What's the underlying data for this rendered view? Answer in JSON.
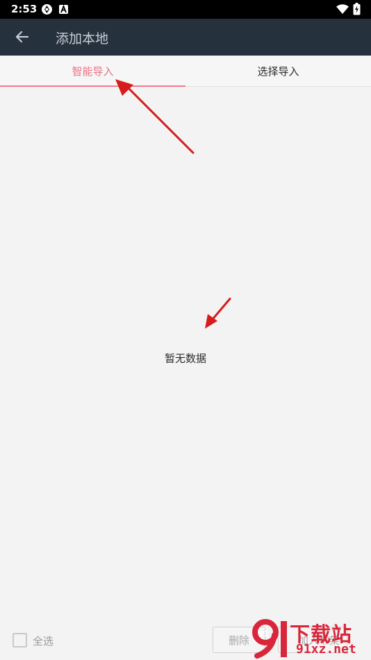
{
  "status_bar": {
    "time": "2:53"
  },
  "app_bar": {
    "title": "添加本地"
  },
  "tabs": [
    {
      "label": "智能导入",
      "active": true
    },
    {
      "label": "选择导入",
      "active": false
    }
  ],
  "main": {
    "empty_text": "暂无数据"
  },
  "bottom_bar": {
    "select_all_label": "全选",
    "delete_label": "删除",
    "add_label": "加入书架"
  },
  "watermark": {
    "cn": "下载站",
    "en": "91xz.net",
    "logo_text": "91"
  },
  "colors": {
    "app_bar_bg": "#26313e",
    "active_tab": "#ec6f82",
    "annotation_arrow": "#d61c1c",
    "watermark": "#d8263a"
  }
}
